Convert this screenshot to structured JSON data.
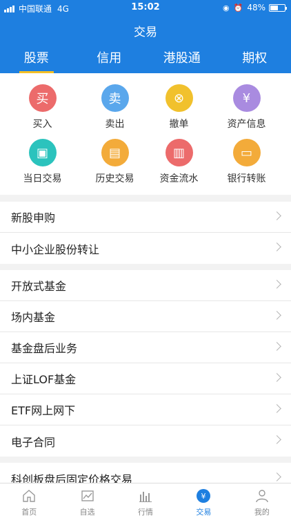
{
  "status_bar": {
    "carrier": "中国联通",
    "network": "4G",
    "time": "15:02",
    "battery": "48%"
  },
  "header": {
    "title": "交易",
    "tabs": [
      {
        "label": "股票",
        "active": true
      },
      {
        "label": "信用",
        "active": false
      },
      {
        "label": "港股通",
        "active": false
      },
      {
        "label": "期权",
        "active": false
      }
    ]
  },
  "grid": [
    {
      "label": "买入",
      "glyph": "买",
      "color": "#ec6b6b",
      "icon": "buy-icon"
    },
    {
      "label": "卖出",
      "glyph": "卖",
      "color": "#5aa7ec",
      "icon": "sell-icon"
    },
    {
      "label": "撤单",
      "glyph": "⊗",
      "color": "#f1c12d",
      "icon": "cancel-order-icon"
    },
    {
      "label": "资产信息",
      "glyph": "¥",
      "color": "#a98be0",
      "icon": "assets-icon"
    },
    {
      "label": "当日交易",
      "glyph": "▣",
      "color": "#2bc3bd",
      "icon": "today-trades-icon"
    },
    {
      "label": "历史交易",
      "glyph": "▤",
      "color": "#f3ab3a",
      "icon": "history-trades-icon"
    },
    {
      "label": "资金流水",
      "glyph": "▥",
      "color": "#ec6b6b",
      "icon": "fund-flow-icon"
    },
    {
      "label": "银行转账",
      "glyph": "▭",
      "color": "#f3ab3a",
      "icon": "bank-transfer-icon"
    }
  ],
  "sections": [
    {
      "items": [
        "新股申购",
        "中小企业股份转让"
      ]
    },
    {
      "items": [
        "开放式基金",
        "场内基金",
        "基金盘后业务",
        "上证LOF基金",
        "ETF网上网下",
        "电子合同"
      ]
    },
    {
      "items": [
        "科创板盘后固定价格交易"
      ]
    }
  ],
  "bottom_nav": [
    {
      "label": "首页",
      "icon": "home-icon",
      "active": false
    },
    {
      "label": "自选",
      "icon": "watchlist-icon",
      "active": false
    },
    {
      "label": "行情",
      "icon": "market-icon",
      "active": false
    },
    {
      "label": "交易",
      "icon": "trade-icon",
      "active": true
    },
    {
      "label": "我的",
      "icon": "profile-icon",
      "active": false
    }
  ],
  "colors": {
    "brand": "#1e7fe0",
    "tab_indicator": "#f5c026"
  }
}
